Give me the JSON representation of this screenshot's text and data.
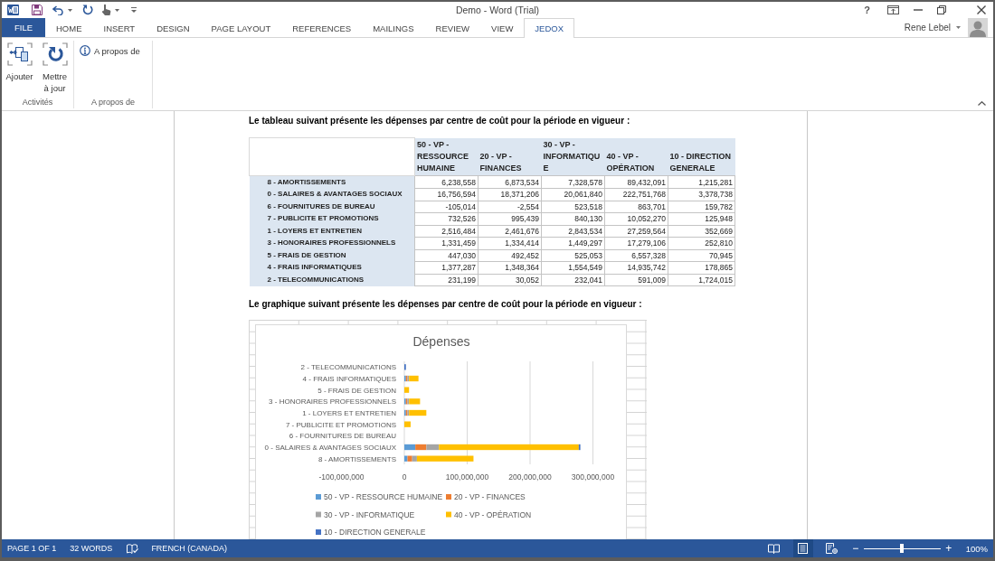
{
  "window": {
    "title": "Demo - Word (Trial)",
    "help": "?"
  },
  "ribbon_tabs": [
    {
      "label": "FILE",
      "kind": "file",
      "selected": false
    },
    {
      "label": "HOME",
      "kind": "tab",
      "selected": false
    },
    {
      "label": "INSERT",
      "kind": "tab",
      "selected": false
    },
    {
      "label": "DESIGN",
      "kind": "tab",
      "selected": false
    },
    {
      "label": "PAGE LAYOUT",
      "kind": "tab",
      "selected": false
    },
    {
      "label": "REFERENCES",
      "kind": "tab",
      "selected": false
    },
    {
      "label": "MAILINGS",
      "kind": "tab",
      "selected": false
    },
    {
      "label": "REVIEW",
      "kind": "tab",
      "selected": false
    },
    {
      "label": "VIEW",
      "kind": "tab",
      "selected": false
    },
    {
      "label": "JEDOX",
      "kind": "tab",
      "selected": true
    }
  ],
  "user": {
    "name": "Rene Lebel"
  },
  "ribbon_groups": [
    {
      "label": "Activités",
      "buttons": [
        {
          "label": "Ajouter",
          "kind": "large"
        },
        {
          "label": "Mettre à jour",
          "kind": "large"
        }
      ]
    },
    {
      "label": "A propos de",
      "buttons": [
        {
          "label": "A propos de",
          "kind": "small"
        }
      ]
    }
  ],
  "document": {
    "table_caption": "Le tableau suivant présente les dépenses par centre de coût pour la période en vigueur :",
    "table": {
      "columns": [
        "50 - VP - RESSOURCE HUMAINE",
        "20 - VP - FINANCES",
        "30 - VP - INFORMATIQUE",
        "40 - VP - OPÉRATION",
        "10 - DIRECTION GENERALE"
      ],
      "rows": [
        {
          "label": "8 - AMORTISSEMENTS",
          "cells": [
            "6,238,558",
            "6,873,534",
            "7,328,578",
            "89,432,091",
            "1,215,281"
          ]
        },
        {
          "label": "0 - SALAIRES & AVANTAGES SOCIAUX",
          "cells": [
            "16,756,594",
            "18,371,206",
            "20,061,840",
            "222,751,768",
            "3,378,738"
          ]
        },
        {
          "label": "6 - FOURNITURES DE BUREAU",
          "cells": [
            "-105,014",
            "-2,554",
            "523,518",
            "863,701",
            "159,782"
          ]
        },
        {
          "label": "7 - PUBLICITE ET PROMOTIONS",
          "cells": [
            "732,526",
            "995,439",
            "840,130",
            "10,052,270",
            "125,948"
          ]
        },
        {
          "label": "1 - LOYERS ET ENTRETIEN",
          "cells": [
            "2,516,484",
            "2,461,676",
            "2,843,534",
            "27,259,564",
            "352,669"
          ]
        },
        {
          "label": "3 - HONORAIRES PROFESSIONNELS",
          "cells": [
            "1,331,459",
            "1,334,414",
            "1,449,297",
            "17,279,106",
            "252,810"
          ]
        },
        {
          "label": "5 - FRAIS DE GESTION",
          "cells": [
            "447,030",
            "492,452",
            "525,053",
            "6,557,328",
            "70,945"
          ]
        },
        {
          "label": "4 - FRAIS INFORMATIQUES",
          "cells": [
            "1,377,287",
            "1,348,364",
            "1,554,549",
            "14,935,742",
            "178,865"
          ]
        },
        {
          "label": "2 - TELECOMMUNICATIONS",
          "cells": [
            "231,199",
            "30,052",
            "232,041",
            "591,009",
            "1,724,015"
          ]
        }
      ]
    },
    "chart_caption": "Le graphique suivant présente les dépenses par centre de coût pour la période en vigueur :",
    "chart": {
      "chart_data": {
        "type": "bar",
        "orientation": "horizontal",
        "stacked": true,
        "title": "Dépenses",
        "categories": [
          "2 - TELECOMMUNICATIONS",
          "4 - FRAIS INFORMATIQUES",
          "5 - FRAIS DE GESTION",
          "3 - HONORAIRES PROFESSIONNELS",
          "1 - LOYERS ET ENTRETIEN",
          "7 - PUBLICITE ET PROMOTIONS",
          "6 - FOURNITURES DE BUREAU",
          "0 - SALAIRES & AVANTAGES SOCIAUX",
          "8 - AMORTISSEMENTS"
        ],
        "series": [
          {
            "name": "50 - VP - RESSOURCE HUMAINE",
            "color": "#5b9bd5",
            "values": [
              0,
              2500000,
              0,
              2500000,
              2500000,
              0,
              0,
              17500000,
              5000000
            ]
          },
          {
            "name": "20 - VP - FINANCES",
            "color": "#ed7d31",
            "values": [
              0,
              2500000,
              0,
              2500000,
              2500000,
              0,
              0,
              17500000,
              7500000
            ]
          },
          {
            "name": "30 - VP - INFORMATIQUE",
            "color": "#a5a5a5",
            "values": [
              0,
              2500000,
              0,
              2500000,
              2500000,
              0,
              0,
              20000000,
              7500000
            ]
          },
          {
            "name": "40 - VP - OPÉRATION",
            "color": "#ffc000",
            "values": [
              0,
              15000000,
              7500000,
              17500000,
              27500000,
              10000000,
              0,
              222500000,
              90000000
            ]
          },
          {
            "name": "10 - DIRECTION GENERALE",
            "color": "#4472c4",
            "values": [
              2500000,
              0,
              0,
              0,
              0,
              0,
              0,
              2500000,
              0
            ]
          }
        ],
        "xlim": [
          -100000000,
          300000000
        ],
        "xticks": [
          {
            "value": -100000000,
            "label": "-100,000,000"
          },
          {
            "value": 0,
            "label": "0"
          },
          {
            "value": 100000000,
            "label": "100,000,000"
          },
          {
            "value": 200000000,
            "label": "200,000,000"
          },
          {
            "value": 300000000,
            "label": "300,000,000"
          }
        ],
        "grid": true,
        "legend": true
      }
    }
  },
  "status_bar": {
    "page": "PAGE 1 OF 1",
    "words": "32 WORDS",
    "language": "FRENCH (CANADA)",
    "views": [
      {
        "kind": "read-mode",
        "selected": false
      },
      {
        "kind": "print-layout",
        "selected": true
      },
      {
        "kind": "web-layout",
        "selected": false
      }
    ],
    "zoom": {
      "minus": "−",
      "plus": "+",
      "level": 0.5,
      "reading": "100%"
    }
  }
}
